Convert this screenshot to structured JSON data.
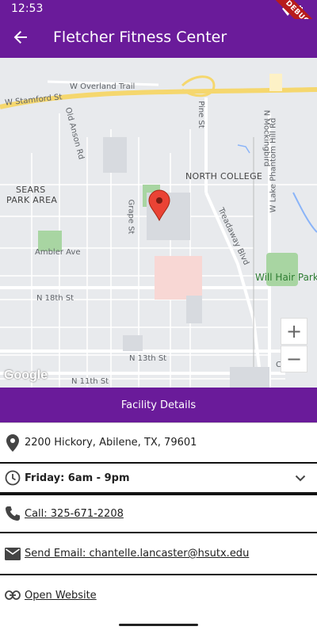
{
  "status_bar": {
    "time": "12:53",
    "debug_label": "DEBUG"
  },
  "app_bar": {
    "title": "Fletcher Fitness Center"
  },
  "map": {
    "labels": {
      "w_overland_trail": "W Overland Trail",
      "w_stamford_st": "W Stamford St",
      "pine_st": "Pine St",
      "n_mockingbird": "N Mockingbird",
      "w_lake_phantom_hill_rd": "W Lake Phantom Hill Rd",
      "old_anson_rd": "Old Anson Rd",
      "sears_park_area_1": "SEARS",
      "sears_park_area_2": "PARK AREA",
      "north_college": "NORTH COLLEGE",
      "grape_st": "Grape St",
      "treadaway_blvd": "Treadaway Blvd",
      "ambler_ave": "Ambler Ave",
      "will_hair_park": "Will Hair Park",
      "n_18th_st": "N 18th St",
      "n_13th_st": "N 13th St",
      "n_11th_st": "N 11th St",
      "college_partial": "Colle"
    },
    "zoom_in_label": "+",
    "zoom_out_label": "−",
    "attribution": "Google"
  },
  "facility": {
    "header": "Facility Details",
    "address": "2200 Hickory, Abilene, TX, 79601",
    "hours": "Friday: 6am - 9pm",
    "phone": "Call: 325-671-2208",
    "email": "Send Email: chantelle.lancaster@hsutx.edu",
    "website": "Open Website"
  }
}
